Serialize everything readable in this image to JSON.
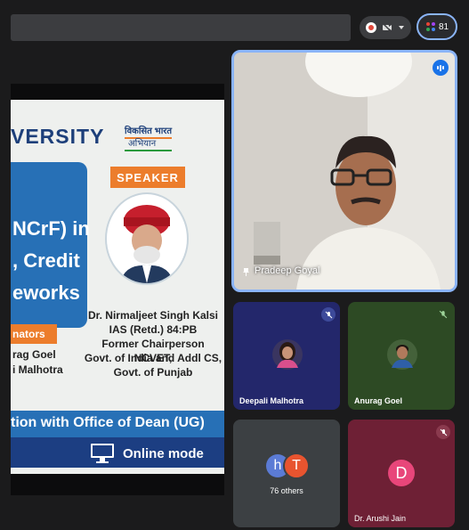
{
  "toolbar": {
    "participant_count": "81"
  },
  "slide": {
    "university_fragment": "VERSITY",
    "logo_line1": "विकसित भारत",
    "logo_line2": "अभियान",
    "title_lines": [
      "NCrF) in",
      ", Credit",
      "eworks"
    ],
    "speaker_label": "SPEAKER",
    "coordinators_label": "nators",
    "coordinator_names": [
      "rag Goel",
      "i Malhotra"
    ],
    "speaker_details": [
      "Dr. Nirmaljeet Singh Kalsi",
      "IAS (Retd.) 84:PB",
      "Former Chairperson NCVET,",
      "Govt. of India and Addl CS,",
      "Govt. of Punjab"
    ],
    "band_text": "tion with Office of Dean (UG)",
    "mode_text": "Online mode"
  },
  "participants": {
    "main": {
      "name": "Pradeep Goyal"
    },
    "tiles": [
      {
        "name": "Deepali Malhotra"
      },
      {
        "name": "Anurag Goel"
      },
      {
        "name": "76 others",
        "avatars": [
          "h",
          "T"
        ]
      },
      {
        "name": "Dr. Arushi Jain",
        "initial": "D"
      }
    ]
  },
  "colors": {
    "accent_blue": "#8ab4f8",
    "slide_blue": "#2770b6",
    "slide_orange": "#ec7d2c",
    "tile_deepali": "#23276b",
    "tile_anurag": "#2d4a24",
    "tile_others": "#3c4043",
    "tile_arushi": "#6e2035"
  }
}
